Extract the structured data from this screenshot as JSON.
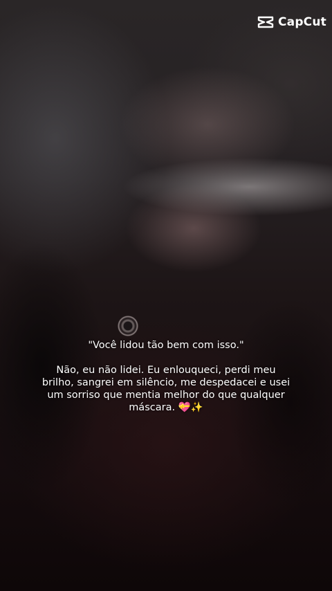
{
  "watermark": {
    "brand": "CapCut",
    "icon": "capcut-logo-icon"
  },
  "caption": {
    "quote": "\"Você lidou tão bem com isso.\"",
    "body": "Não, eu não lidei. Eu enlouqueci, perdi meu brilho, sangrei em silêncio, me despedacei e usei um sorriso que mentia melhor do que qualquer máscara. 💝✨"
  }
}
